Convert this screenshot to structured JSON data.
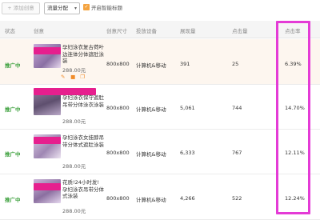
{
  "toolbar": {
    "add_label": "+ 添加创意",
    "traffic_label": "流量分配",
    "smart_title_label": "开启智能标题"
  },
  "columns": [
    "状态",
    "创意",
    "创意尺寸",
    "投放设备",
    "展现量",
    "点击量",
    "点击率"
  ],
  "rows": [
    {
      "status": "推广中",
      "title": "孕妇泳衣复古荷叶边连体分体遮肚泳装",
      "price": "288.00元",
      "size": "800x800",
      "device": "计算机&移动",
      "impressions": "391",
      "clicks": "25",
      "ctr": "6.39%"
    },
    {
      "status": "推广中",
      "title": "孕妇泳衣保守遮肚吊带分体泳衣泳装",
      "price": "288.00元",
      "size": "800x800",
      "device": "计算机&移动",
      "impressions": "5,061",
      "clicks": "744",
      "ctr": "14.70%"
    },
    {
      "status": "推广中",
      "title": "孕妇泳衣女挂脖吊带分体式遮肚泳装",
      "price": "288.00元",
      "size": "800x800",
      "device": "计算机&移动",
      "impressions": "6,333",
      "clicks": "767",
      "ctr": "12.11%"
    },
    {
      "status": "推广中",
      "title": "花质!24小时发!孕妇泳衣吊带分体式泳装",
      "price": "288.00元",
      "size": "800x800",
      "device": "计算机&移动",
      "impressions": "4,266",
      "clicks": "522",
      "ctr": "12.24%"
    }
  ],
  "colors": {
    "status": "#3fa13f",
    "highlight": "#e43bd6",
    "accent": "#f4a340"
  }
}
